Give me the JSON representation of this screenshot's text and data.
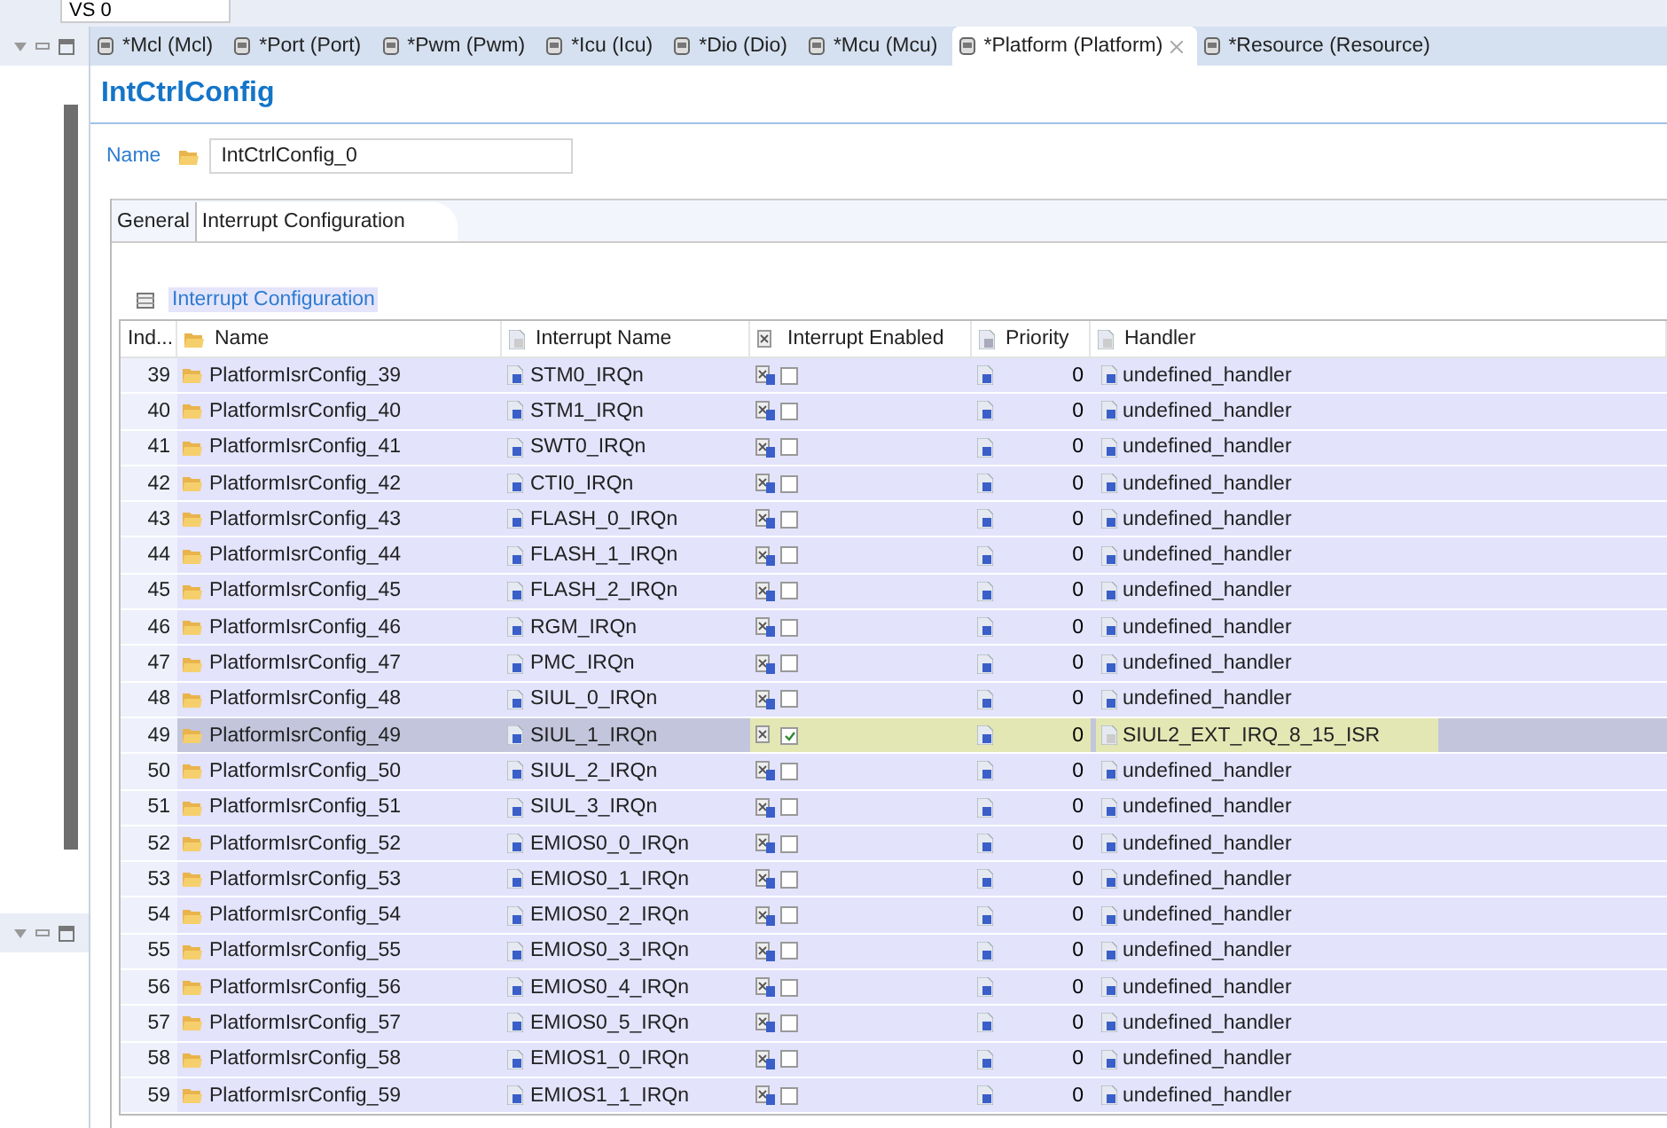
{
  "top_field": {
    "value": "VS 0"
  },
  "editor_tabs": [
    {
      "label": "*Mcl (Mcl)",
      "selected": false
    },
    {
      "label": "*Port (Port)",
      "selected": false
    },
    {
      "label": "*Pwm (Pwm)",
      "selected": false
    },
    {
      "label": "*Icu (Icu)",
      "selected": false
    },
    {
      "label": "*Dio (Dio)",
      "selected": false
    },
    {
      "label": "*Mcu (Mcu)",
      "selected": false
    },
    {
      "label": "*Platform (Platform)",
      "selected": true
    },
    {
      "label": "*Resource (Resource)",
      "selected": false
    }
  ],
  "title": "IntCtrlConfig",
  "name_field": {
    "label": "Name",
    "value": "IntCtrlConfig_0"
  },
  "sub_tabs": [
    {
      "label": "General",
      "selected": false
    },
    {
      "label": "Interrupt Configuration",
      "selected": true
    }
  ],
  "section_title": "Interrupt Configuration",
  "table": {
    "columns": [
      "Ind...",
      "Name",
      "Interrupt Name",
      "Interrupt Enabled",
      "Priority",
      "Handler"
    ],
    "rows": [
      {
        "index": "39",
        "name": "PlatformIsrConfig_39",
        "interrupt_name": "STM0_IRQn",
        "enabled": false,
        "priority": "0",
        "handler": "undefined_handler",
        "selected": false
      },
      {
        "index": "40",
        "name": "PlatformIsrConfig_40",
        "interrupt_name": "STM1_IRQn",
        "enabled": false,
        "priority": "0",
        "handler": "undefined_handler",
        "selected": false
      },
      {
        "index": "41",
        "name": "PlatformIsrConfig_41",
        "interrupt_name": "SWT0_IRQn",
        "enabled": false,
        "priority": "0",
        "handler": "undefined_handler",
        "selected": false
      },
      {
        "index": "42",
        "name": "PlatformIsrConfig_42",
        "interrupt_name": "CTI0_IRQn",
        "enabled": false,
        "priority": "0",
        "handler": "undefined_handler",
        "selected": false
      },
      {
        "index": "43",
        "name": "PlatformIsrConfig_43",
        "interrupt_name": "FLASH_0_IRQn",
        "enabled": false,
        "priority": "0",
        "handler": "undefined_handler",
        "selected": false
      },
      {
        "index": "44",
        "name": "PlatformIsrConfig_44",
        "interrupt_name": "FLASH_1_IRQn",
        "enabled": false,
        "priority": "0",
        "handler": "undefined_handler",
        "selected": false
      },
      {
        "index": "45",
        "name": "PlatformIsrConfig_45",
        "interrupt_name": "FLASH_2_IRQn",
        "enabled": false,
        "priority": "0",
        "handler": "undefined_handler",
        "selected": false
      },
      {
        "index": "46",
        "name": "PlatformIsrConfig_46",
        "interrupt_name": "RGM_IRQn",
        "enabled": false,
        "priority": "0",
        "handler": "undefined_handler",
        "selected": false
      },
      {
        "index": "47",
        "name": "PlatformIsrConfig_47",
        "interrupt_name": "PMC_IRQn",
        "enabled": false,
        "priority": "0",
        "handler": "undefined_handler",
        "selected": false
      },
      {
        "index": "48",
        "name": "PlatformIsrConfig_48",
        "interrupt_name": "SIUL_0_IRQn",
        "enabled": false,
        "priority": "0",
        "handler": "undefined_handler",
        "selected": false
      },
      {
        "index": "49",
        "name": "PlatformIsrConfig_49",
        "interrupt_name": "SIUL_1_IRQn",
        "enabled": true,
        "priority": "0",
        "handler": "SIUL2_EXT_IRQ_8_15_ISR",
        "selected": true
      },
      {
        "index": "50",
        "name": "PlatformIsrConfig_50",
        "interrupt_name": "SIUL_2_IRQn",
        "enabled": false,
        "priority": "0",
        "handler": "undefined_handler",
        "selected": false
      },
      {
        "index": "51",
        "name": "PlatformIsrConfig_51",
        "interrupt_name": "SIUL_3_IRQn",
        "enabled": false,
        "priority": "0",
        "handler": "undefined_handler",
        "selected": false
      },
      {
        "index": "52",
        "name": "PlatformIsrConfig_52",
        "interrupt_name": "EMIOS0_0_IRQn",
        "enabled": false,
        "priority": "0",
        "handler": "undefined_handler",
        "selected": false
      },
      {
        "index": "53",
        "name": "PlatformIsrConfig_53",
        "interrupt_name": "EMIOS0_1_IRQn",
        "enabled": false,
        "priority": "0",
        "handler": "undefined_handler",
        "selected": false
      },
      {
        "index": "54",
        "name": "PlatformIsrConfig_54",
        "interrupt_name": "EMIOS0_2_IRQn",
        "enabled": false,
        "priority": "0",
        "handler": "undefined_handler",
        "selected": false
      },
      {
        "index": "55",
        "name": "PlatformIsrConfig_55",
        "interrupt_name": "EMIOS0_3_IRQn",
        "enabled": false,
        "priority": "0",
        "handler": "undefined_handler",
        "selected": false
      },
      {
        "index": "56",
        "name": "PlatformIsrConfig_56",
        "interrupt_name": "EMIOS0_4_IRQn",
        "enabled": false,
        "priority": "0",
        "handler": "undefined_handler",
        "selected": false
      },
      {
        "index": "57",
        "name": "PlatformIsrConfig_57",
        "interrupt_name": "EMIOS0_5_IRQn",
        "enabled": false,
        "priority": "0",
        "handler": "undefined_handler",
        "selected": false
      },
      {
        "index": "58",
        "name": "PlatformIsrConfig_58",
        "interrupt_name": "EMIOS1_0_IRQn",
        "enabled": false,
        "priority": "0",
        "handler": "undefined_handler",
        "selected": false
      },
      {
        "index": "59",
        "name": "PlatformIsrConfig_59",
        "interrupt_name": "EMIOS1_1_IRQn",
        "enabled": false,
        "priority": "0",
        "handler": "undefined_handler",
        "selected": false
      }
    ]
  }
}
